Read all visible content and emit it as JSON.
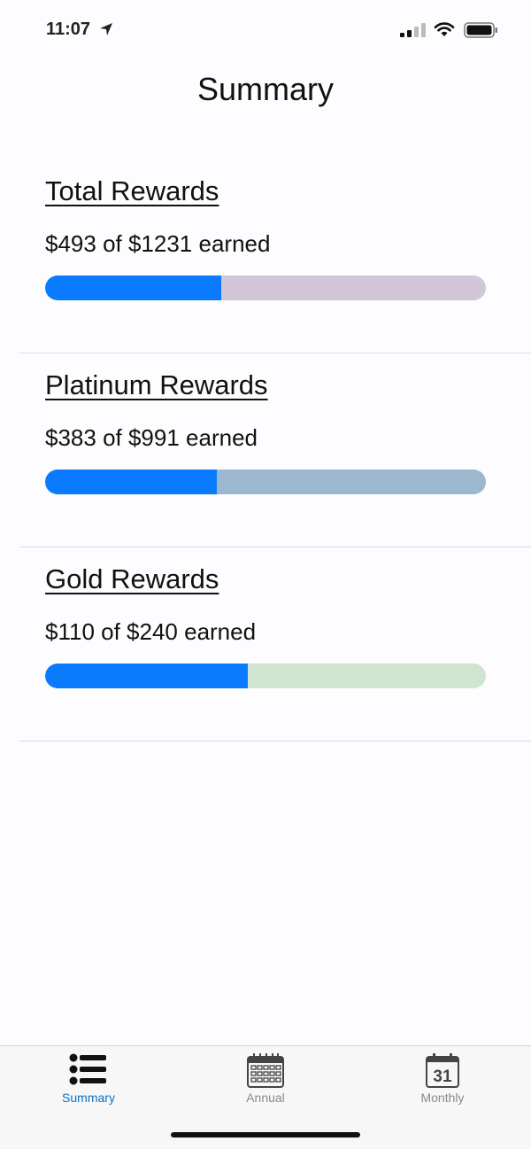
{
  "status_bar": {
    "time": "11:07"
  },
  "page": {
    "title": "Summary"
  },
  "rewards": [
    {
      "title": "Total Rewards",
      "amount_text": "$493 of $1231 earned",
      "earned": 493,
      "total": 1231,
      "progress": 0.4,
      "track_color": "#d2c7d8",
      "fill_color": "#0a7afe"
    },
    {
      "title": "Platinum Rewards",
      "amount_text": "$383 of $991 earned",
      "earned": 383,
      "total": 991,
      "progress": 0.39,
      "track_color": "#9cb8ce",
      "fill_color": "#0a7afe"
    },
    {
      "title": "Gold Rewards",
      "amount_text": "$110 of $240 earned",
      "earned": 110,
      "total": 240,
      "progress": 0.46,
      "track_color": "#cfe5cf",
      "fill_color": "#0a7afe"
    }
  ],
  "tab_bar": {
    "tabs": [
      {
        "label": "Summary",
        "icon": "list-icon",
        "active": true
      },
      {
        "label": "Annual",
        "icon": "calendar-grid-icon",
        "active": false
      },
      {
        "label": "Monthly",
        "icon": "calendar-31-icon",
        "active": false,
        "icon_text": "31"
      }
    ],
    "active_color": "#0a6fc2",
    "inactive_color": "#8a8a8e"
  }
}
